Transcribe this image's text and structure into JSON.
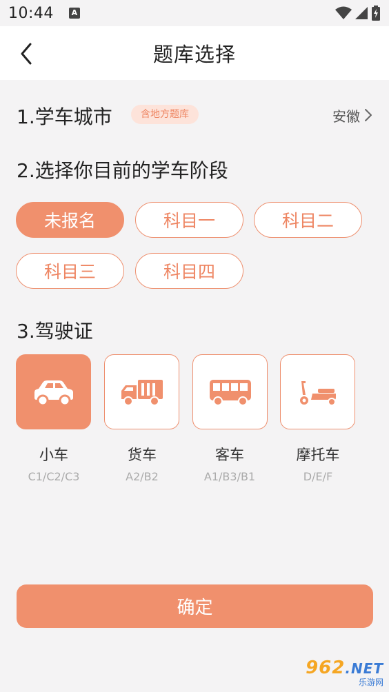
{
  "status_bar": {
    "time": "10:44",
    "notification_icon": "A",
    "icons": [
      "wifi-icon",
      "signal-icon",
      "battery-icon"
    ]
  },
  "header": {
    "title": "题库选择"
  },
  "section1": {
    "title": "1.学车城市",
    "badge": "含地方题库",
    "city": "安徽"
  },
  "section2": {
    "title": "2.选择你目前的学车阶段",
    "stages": [
      {
        "label": "未报名",
        "selected": true
      },
      {
        "label": "科目一",
        "selected": false
      },
      {
        "label": "科目二",
        "selected": false
      },
      {
        "label": "科目三",
        "selected": false
      },
      {
        "label": "科目四",
        "selected": false
      }
    ]
  },
  "section3": {
    "title": "3.驾驶证",
    "vehicles": [
      {
        "name": "小车",
        "code": "C1/C2/C3",
        "icon": "car-icon",
        "selected": true
      },
      {
        "name": "货车",
        "code": "A2/B2",
        "icon": "truck-icon",
        "selected": false
      },
      {
        "name": "客车",
        "code": "A1/B3/B1",
        "icon": "bus-icon",
        "selected": false
      },
      {
        "name": "摩托车",
        "code": "D/E/F",
        "icon": "scooter-icon",
        "selected": false
      }
    ]
  },
  "confirm_label": "确定",
  "watermark": {
    "brand": "962",
    "suffix": ".NET",
    "sub": "乐游网"
  },
  "colors": {
    "accent": "#f0906d",
    "accent_text": "#ee8663",
    "badge_bg": "#fde3da",
    "background": "#f4f3f4"
  }
}
